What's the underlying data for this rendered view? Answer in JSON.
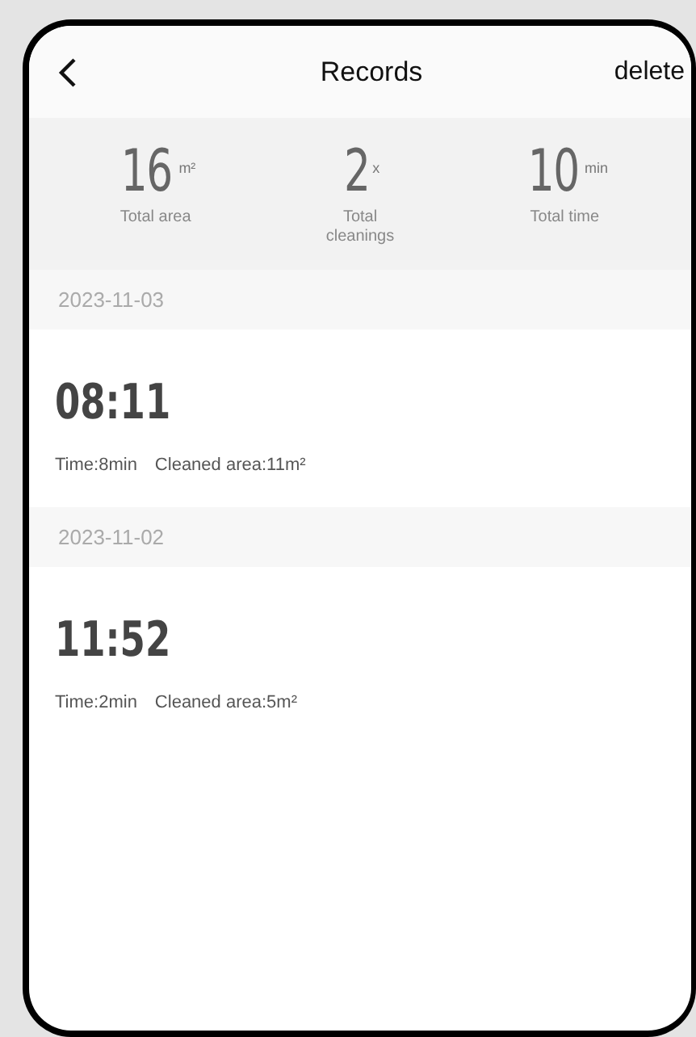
{
  "header": {
    "title": "Records",
    "action": "delete"
  },
  "stats": [
    {
      "value": "16",
      "unit": "m²",
      "label": "Total area"
    },
    {
      "value": "2",
      "unit": "x",
      "label": "Total cleanings"
    },
    {
      "value": "10",
      "unit": "min",
      "label": "Total time"
    }
  ],
  "groups": [
    {
      "date": "2023-11-03",
      "records": [
        {
          "time": "08:11",
          "duration": "Time:8min",
          "area": "Cleaned area:11m²"
        }
      ]
    },
    {
      "date": "2023-11-02",
      "records": [
        {
          "time": "11:52",
          "duration": "Time:2min",
          "area": "Cleaned area:5m²"
        }
      ]
    }
  ]
}
